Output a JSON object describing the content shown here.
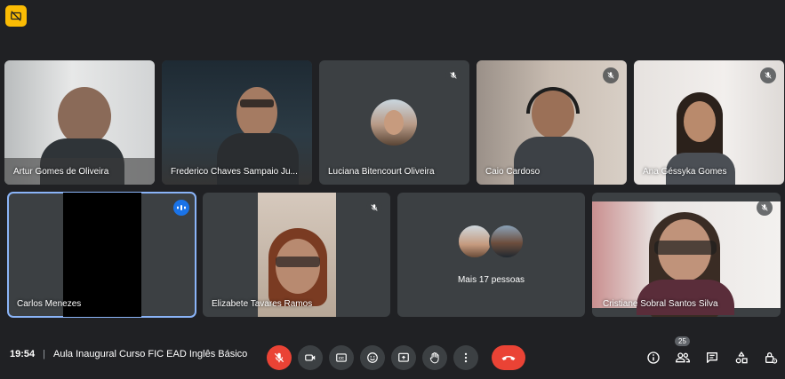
{
  "participants": [
    {
      "name": "Artur Gomes de Oliveira"
    },
    {
      "name": "Frederico Chaves Sampaio Ju..."
    },
    {
      "name": "Luciana Bitencourt Oliveira"
    },
    {
      "name": "Caio Cardoso"
    },
    {
      "name": "Ana Géssyka Gomes"
    },
    {
      "name": "Carlos Menezes"
    },
    {
      "name": "Elizabete Tavares Ramos"
    },
    {
      "name": "Cristiane Sobral Santos Silva"
    }
  ],
  "more_people": "Mais 17 pessoas",
  "meeting": {
    "time": "19:54",
    "separator": "|",
    "title": "Aula Inaugural Curso FIC EAD Inglês Básico"
  },
  "participant_count": "25",
  "colors": {
    "background": "#202124",
    "tile": "#3c4043",
    "danger": "#ea4335",
    "active_outline": "#8ab4f8",
    "speaking": "#1a73e8",
    "recording": "#fbbc04"
  },
  "icons": [
    "recording-icon",
    "mic-off-icon",
    "camera-icon",
    "captions-icon",
    "emoji-icon",
    "present-icon",
    "raise-hand-icon",
    "more-options-icon",
    "hang-up-icon",
    "info-icon",
    "people-icon",
    "chat-icon",
    "activities-icon",
    "host-controls-icon"
  ]
}
